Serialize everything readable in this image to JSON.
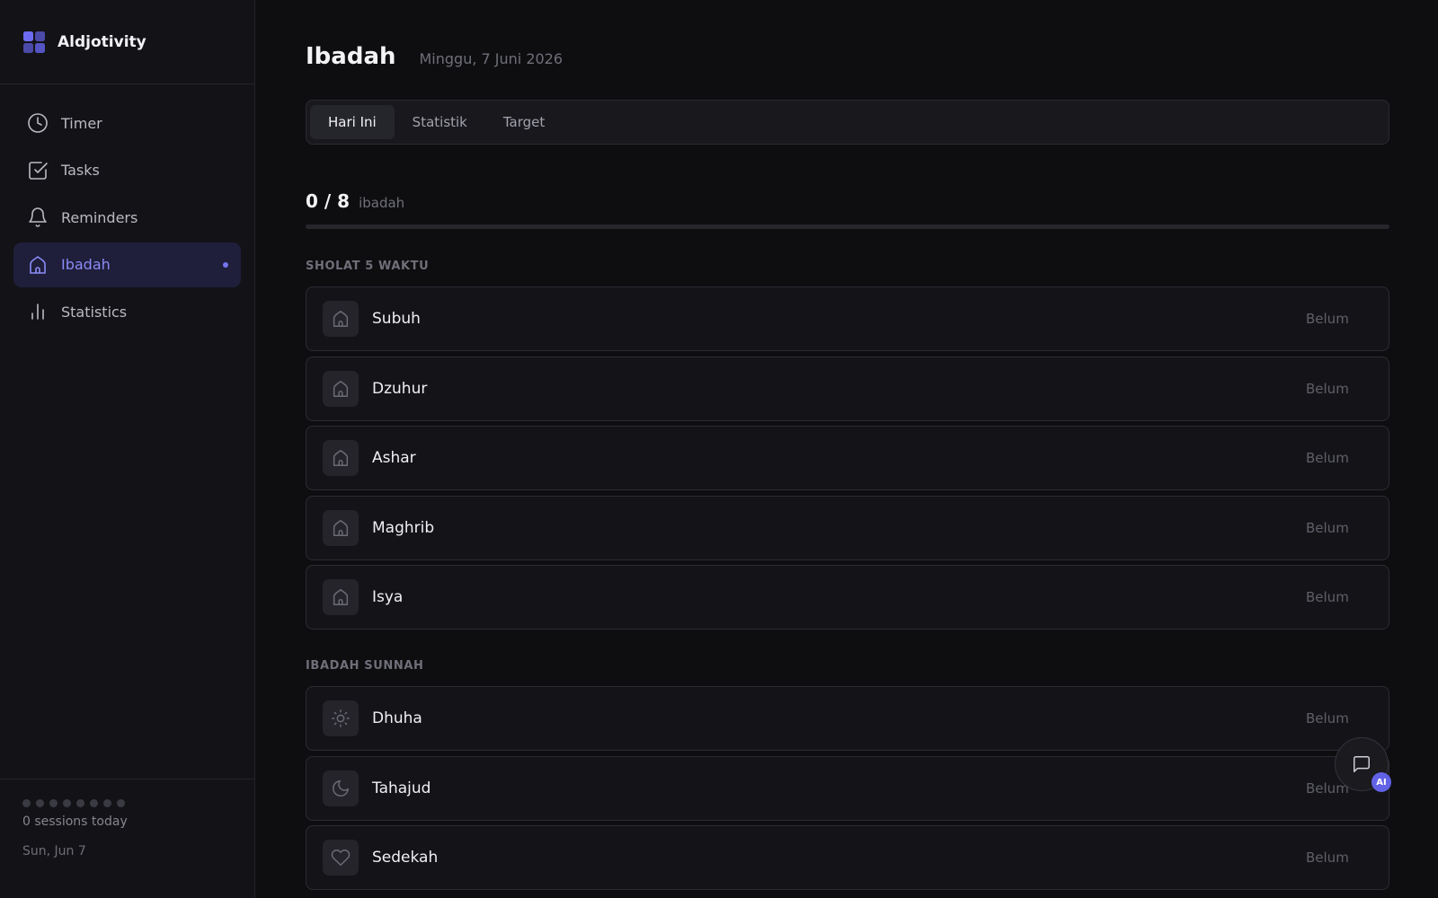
{
  "app": {
    "name": "Aldjotivity"
  },
  "sidebar": {
    "items": [
      {
        "label": "Timer",
        "icon": "clock-icon"
      },
      {
        "label": "Tasks",
        "icon": "checkbox-icon"
      },
      {
        "label": "Reminders",
        "icon": "bell-icon"
      },
      {
        "label": "Ibadah",
        "icon": "mosque-icon",
        "active": true
      },
      {
        "label": "Statistics",
        "icon": "bar-chart-icon"
      }
    ],
    "footer": {
      "sessions": "0 sessions today",
      "date": "Sun, Jun 7",
      "session_dots": 8
    }
  },
  "header": {
    "title": "Ibadah",
    "date": "Minggu, 7 Juni 2026"
  },
  "tabs": [
    {
      "label": "Hari Ini",
      "active": true
    },
    {
      "label": "Statistik"
    },
    {
      "label": "Target"
    }
  ],
  "progress": {
    "count": "0 / 8",
    "unit": "ibadah",
    "fraction": 0
  },
  "sections": [
    {
      "title": "SHOLAT 5 WAKTU",
      "items": [
        {
          "name": "Subuh",
          "status": "Belum",
          "icon": "mosque-icon"
        },
        {
          "name": "Dzuhur",
          "status": "Belum",
          "icon": "mosque-icon"
        },
        {
          "name": "Ashar",
          "status": "Belum",
          "icon": "mosque-icon"
        },
        {
          "name": "Maghrib",
          "status": "Belum",
          "icon": "mosque-icon"
        },
        {
          "name": "Isya",
          "status": "Belum",
          "icon": "mosque-icon"
        }
      ]
    },
    {
      "title": "IBADAH SUNNAH",
      "items": [
        {
          "name": "Dhuha",
          "status": "Belum",
          "icon": "sun-icon"
        },
        {
          "name": "Tahajud",
          "status": "Belum",
          "icon": "moon-icon"
        },
        {
          "name": "Sedekah",
          "status": "Belum",
          "icon": "heart-icon"
        }
      ]
    }
  ],
  "ai_button": {
    "badge": "AI",
    "icon": "chat-icon"
  },
  "colors": {
    "accent": "#6d6cf0",
    "active_nav_bg": "#1f1e3b",
    "background": "#0e0e11"
  }
}
